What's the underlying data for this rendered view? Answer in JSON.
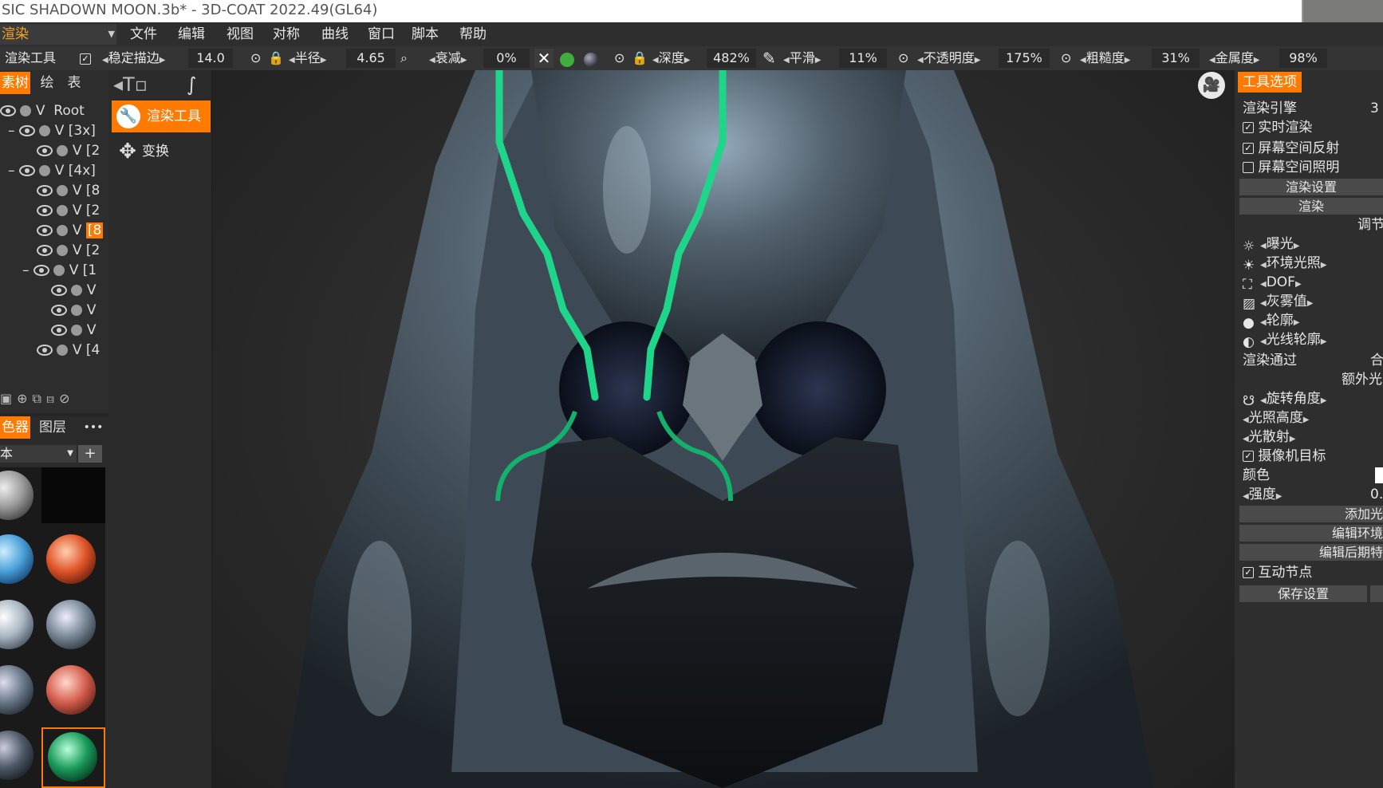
{
  "window": {
    "title": "SIC SHADOWN MOON.3b* - 3D-COAT 2022.49(GL64)"
  },
  "room": {
    "selected": "渲染"
  },
  "menu": [
    "文件",
    "编辑",
    "视图",
    "对称",
    "曲线",
    "窗口",
    "脚本",
    "帮助"
  ],
  "toolbar": {
    "tool_name": "渲染工具",
    "stabilize_label": "稳定描边",
    "stabilize_value": "14.0",
    "radius_label": "半径",
    "radius_value": "4.65",
    "falloff_label": "衰减",
    "falloff_value": "0%",
    "depth_label": "深度",
    "depth_value": "482%",
    "smooth_label": "平滑",
    "smooth_value": "11%",
    "opacity_label": "不透明度",
    "opacity_value": "175%",
    "roughness_label": "粗糙度",
    "roughness_value": "31%",
    "metal_label": "金属度",
    "metal_value": "98%"
  },
  "tree": {
    "tabs": [
      "素树",
      "绘",
      "表"
    ],
    "rows": [
      {
        "prefix": "",
        "text": "Root"
      },
      {
        "prefix": "–",
        "text": "[3x]"
      },
      {
        "prefix": "",
        "text": "[2"
      },
      {
        "prefix": "–",
        "text": "[4x]"
      },
      {
        "prefix": "",
        "text": "[8"
      },
      {
        "prefix": "",
        "text": "[2"
      },
      {
        "prefix": "",
        "text": "[8"
      },
      {
        "prefix": "",
        "text": "[2"
      },
      {
        "prefix": "–",
        "text": "[1"
      },
      {
        "prefix": "",
        "text": ""
      },
      {
        "prefix": "",
        "text": ""
      },
      {
        "prefix": "",
        "text": ""
      },
      {
        "prefix": "",
        "text": "[4"
      }
    ],
    "v_label": "V"
  },
  "materials": {
    "tabs": [
      "色器",
      "图层"
    ],
    "more": "•••",
    "filter": "本",
    "add": "+"
  },
  "tools": {
    "active": "渲染工具",
    "transform": "变换"
  },
  "right_panel": {
    "header": "工具选项",
    "engine_label": "渲染引擎",
    "engine_value": "3",
    "realtime": "实时渲染",
    "ssr": "屏幕空间反射",
    "ssl": "屏幕空间照明",
    "render_settings": "渲染设置",
    "render": "渲染",
    "adjust": "调节",
    "effects": [
      "曝光",
      "环境光照",
      "DOF",
      "灰雾值",
      "轮廓",
      "光线轮廓"
    ],
    "render_pass": "渲染通过",
    "render_pass_value": "合",
    "extra_light": "额外光",
    "rotate_angle": "旋转角度",
    "light_height": "光照高度",
    "light_scatter": "光散射",
    "camera_target": "摄像机目标",
    "color": "颜色",
    "intensity": "强度",
    "intensity_value": "0.",
    "add_light": "添加光",
    "edit_env": "编辑环境",
    "edit_post": "编辑后期特",
    "interactive_nodes": "互动节点",
    "save_settings": "保存设置"
  }
}
